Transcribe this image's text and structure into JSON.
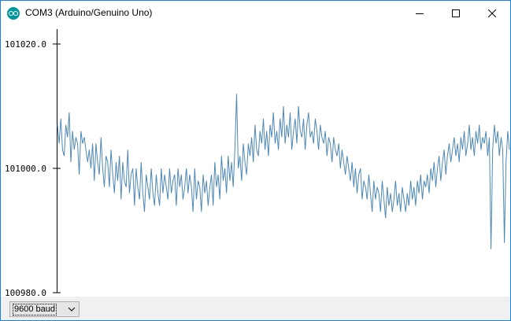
{
  "window": {
    "title": "COM3 (Arduino/Genuino Uno)",
    "icon": "arduino-icon",
    "controls": [
      "minimize-icon",
      "maximize-icon",
      "close-icon"
    ]
  },
  "plotter": {
    "line_color": "#4e88b5",
    "baud_rate": "9600 baud"
  },
  "chart_data": {
    "type": "line",
    "title": "",
    "xlabel": "",
    "ylabel": "",
    "y_ticks": [
      "101020.0",
      "101000.0",
      "100980.0"
    ],
    "ylim": [
      100980,
      101020.5
    ],
    "grid": false,
    "legend": "none",
    "series": [
      {
        "values": [
          101007,
          101004,
          101008,
          101003,
          101002,
          101007,
          101005,
          101009,
          101001,
          101006,
          101003,
          101005,
          101004,
          100999,
          101006,
          101004,
          101005,
          101003,
          101001,
          101003,
          101000,
          101004,
          100998,
          101004,
          101001,
          100999,
          101005,
          101000,
          100997,
          101002,
          101001,
          100997,
          101003,
          100999,
          100996,
          101001,
          100998,
          101002,
          100995,
          101001,
          100998,
          100997,
          101003,
          100996,
          100999,
          101000,
          100994,
          101000,
          100997,
          100995,
          101001,
          100996,
          100993,
          100999,
          100997,
          100995,
          101000,
          100996,
          100994,
          100999,
          100996,
          100994,
          101000,
          100996,
          100999,
          100997,
          100995,
          101000,
          100996,
          100998,
          100999,
          100994,
          101000,
          100997,
          100999,
          100995,
          100997,
          101000,
          100996,
          100999,
          100997,
          100993,
          101000,
          100995,
          100998,
          100997,
          100993,
          100999,
          100996,
          100998,
          100994,
          100997,
          100999,
          100994,
          101001,
          100997,
          100999,
          100995,
          101002,
          100998,
          101000,
          100996,
          101002,
          100998,
          101001,
          100997,
          101003,
          101000,
          101002,
          100998,
          101004,
          101001,
          100999,
          101004,
          101002,
          101005,
          101001,
          101007,
          101003,
          101002,
          101006,
          101004,
          101008,
          101003,
          101006,
          101002,
          101007,
          101005,
          101009,
          101004,
          101006,
          101003,
          101008,
          101005,
          101010,
          101004,
          101007,
          101005,
          101009,
          101003,
          101006,
          101008,
          101004,
          101010,
          101006,
          101005,
          101008,
          101003,
          101007,
          101009,
          101005,
          101006,
          101004,
          101008,
          101006,
          101003,
          101007,
          101005,
          101004,
          101006,
          101002,
          101005,
          101004,
          101001,
          101005,
          101003,
          101002,
          101004,
          101000,
          101003,
          101001,
          100999,
          101002,
          101000,
          100998,
          101001,
          100997,
          101000,
          100996,
          100999,
          101000,
          100995,
          100998,
          100997,
          100995,
          100999,
          100996,
          100993,
          100998,
          100995,
          100997,
          100996,
          100993,
          100998,
          100995,
          100992,
          100997,
          100994,
          100996,
          100993,
          100995,
          100998,
          100994,
          100996,
          100993,
          100997,
          100995,
          100993,
          100996,
          100994,
          100998,
          100995,
          100997,
          100994,
          100998,
          100996,
          100999,
          100995,
          100998,
          100997,
          100999,
          100996,
          101000,
          100998,
          101001,
          100997,
          101000,
          101002,
          100998,
          101001,
          101003,
          100999,
          101002,
          101004,
          101001,
          101003,
          101005,
          101002,
          101004,
          101001,
          101005,
          101003,
          101006,
          101002,
          101004,
          101007,
          101003,
          101005,
          101002,
          101006,
          101004,
          101007,
          101003,
          101005,
          101004,
          101006,
          101002,
          101005,
          101003,
          101007,
          101004,
          101006,
          101002,
          101005,
          101003,
          100988,
          101001,
          101006,
          101003
        ],
        "min": 100987,
        "max": 101012
      }
    ]
  }
}
